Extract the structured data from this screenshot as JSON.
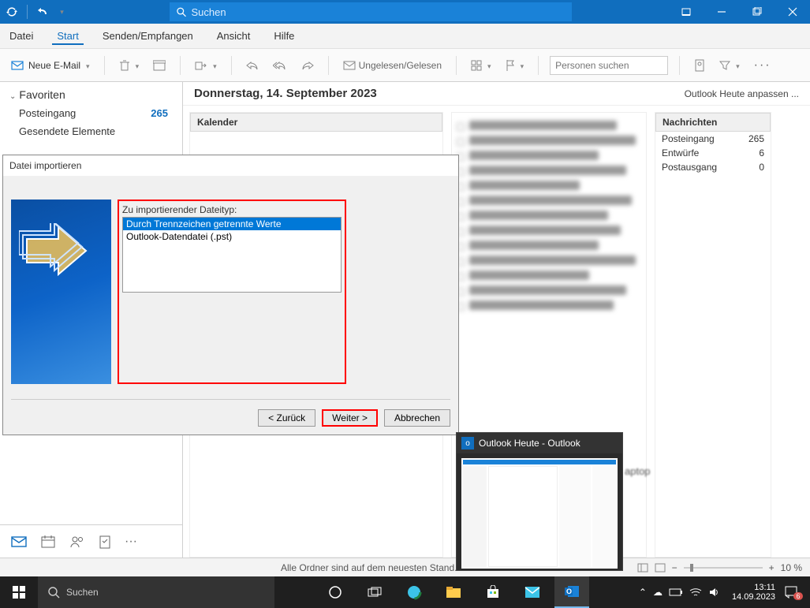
{
  "titlebar": {
    "search_placeholder": "Suchen"
  },
  "menubar": {
    "items": [
      "Datei",
      "Start",
      "Senden/Empfangen",
      "Ansicht",
      "Hilfe"
    ],
    "active_index": 1
  },
  "toolbar": {
    "new_mail": "Neue E-Mail",
    "unread_read": "Ungelesen/Gelesen",
    "search_people_placeholder": "Personen suchen"
  },
  "sidebar": {
    "favorites_label": "Favoriten",
    "items": [
      {
        "label": "Posteingang",
        "count": "265"
      },
      {
        "label": "Gesendete Elemente",
        "count": ""
      }
    ]
  },
  "content": {
    "date": "Donnerstag, 14. September 2023",
    "customize": "Outlook Heute anpassen ...",
    "panels": {
      "calendar": "Kalender",
      "messages": "Nachrichten",
      "message_rows": [
        {
          "label": "Posteingang",
          "count": "265"
        },
        {
          "label": "Entwürfe",
          "count": "6"
        },
        {
          "label": "Postausgang",
          "count": "0"
        }
      ]
    }
  },
  "dialog": {
    "title": "Datei importieren",
    "filetype_label": "Zu importierender Dateityp:",
    "options": [
      "Durch Trennzeichen getrennte Werte",
      "Outlook-Datendatei (.pst)"
    ],
    "selected_index": 0,
    "back": "< Zurück",
    "next": "Weiter >",
    "cancel": "Abbrechen"
  },
  "thumb": {
    "title": "Outlook Heute - Outlook"
  },
  "statusbar": {
    "text": "Alle Ordner sind auf dem neuesten Stand.",
    "zoom": "10 %"
  },
  "taskbar": {
    "search": "Suchen",
    "time": "13:11",
    "date": "14.09.2023",
    "notif": "6"
  },
  "misc": {
    "laptop": "aptop"
  }
}
